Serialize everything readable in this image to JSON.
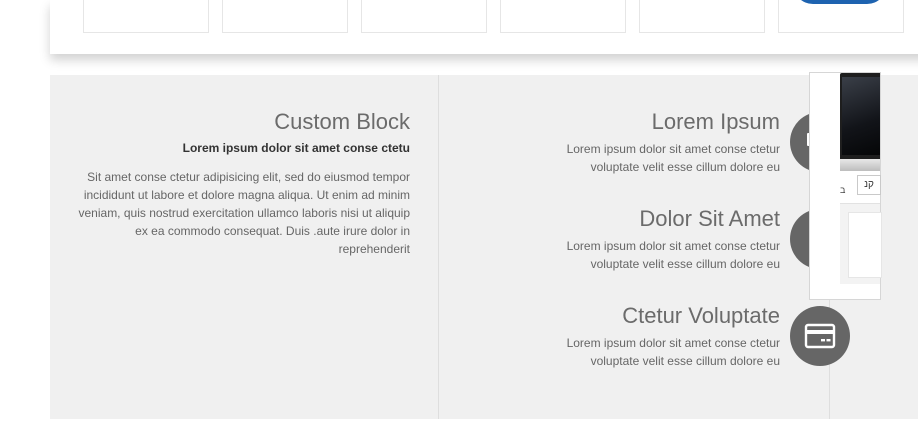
{
  "custom_block": {
    "title": "Custom Block",
    "subtitle": "Lorem ipsum dolor sit amet conse ctetu",
    "body": "Sit amet conse ctetur adipisicing elit, sed do eiusmod tempor incididunt ut labore et dolore magna aliqua. Ut enim ad minim veniam, quis nostrud exercitation ullamco laboris nisi ut aliquip ex ea commodo consequat. Duis .aute irure dolor in reprehenderit"
  },
  "services": [
    {
      "title": "Lorem Ipsum",
      "desc": "Lorem ipsum dolor sit amet conse ctetur voluptate velit esse cillum dolore eu",
      "icon": "truck-icon"
    },
    {
      "title": "Dolor Sit Amet",
      "desc": "Lorem ipsum dolor sit amet conse ctetur voluptate velit esse cillum dolore eu",
      "icon": "phone-icon"
    },
    {
      "title": "Ctetur Voluptate",
      "desc": "Lorem ipsum dolor sit amet conse ctetur voluptate velit esse cillum dolore eu",
      "icon": "credit-card-icon"
    }
  ],
  "product_widget": {
    "label": "קנ",
    "mini_text": "ב"
  },
  "colors": {
    "band_background": "#f0f0f0",
    "icon_circle": "#666666",
    "heading": "#6b6b6b",
    "text": "#666666"
  }
}
